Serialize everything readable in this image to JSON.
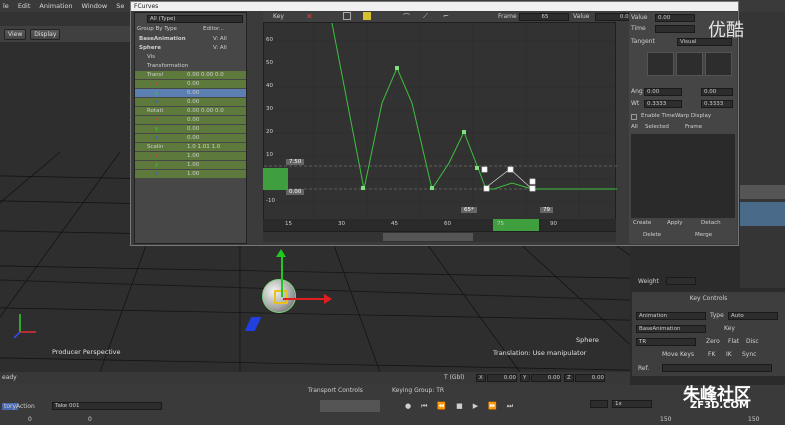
{
  "menu": [
    "le",
    "Edit",
    "Animation",
    "Window",
    "Se"
  ],
  "toolbar": {
    "view_label": "View",
    "display_label": "Display"
  },
  "viewport": {
    "camera_label": "Producer Perspective",
    "object_label": "Sphere",
    "status": "Translation: Use manipulator",
    "coords": {
      "prefix": "T (Gbl)",
      "x_label": "X",
      "x": "0.00",
      "y_label": "Y",
      "y": "0.00",
      "z_label": "Z",
      "z": "0.00"
    },
    "status_left": "eady"
  },
  "fcurves": {
    "title": "FCurves",
    "filter": "All (Type)",
    "group_by": "Group By Type",
    "editor": "Editor...",
    "tree": [
      {
        "indent": 0,
        "label": "BaseAnimation",
        "value": "V: All",
        "type": "header"
      },
      {
        "indent": 0,
        "label": "Sphere",
        "value": "V: All",
        "type": "header"
      },
      {
        "indent": 1,
        "label": "Vis",
        "value": "",
        "type": "item"
      },
      {
        "indent": 1,
        "label": "Transformation",
        "value": "",
        "type": "group"
      },
      {
        "indent": 1,
        "label": "Transl",
        "value": "0.00 0.00 0.0",
        "type": "prop"
      },
      {
        "indent": 2,
        "label": "x",
        "value": "0.00",
        "type": "channel",
        "color": "#ff3030"
      },
      {
        "indent": 2,
        "label": "y",
        "value": "0.00",
        "type": "channel",
        "color": "#30d030",
        "selected": true
      },
      {
        "indent": 2,
        "label": "z",
        "value": "0.00",
        "type": "channel",
        "color": "#3050ff"
      },
      {
        "indent": 1,
        "label": "Rotati",
        "value": "0.00 0.00 0.0",
        "type": "prop"
      },
      {
        "indent": 2,
        "label": "x",
        "value": "0.00",
        "type": "channel",
        "color": "#ff3030"
      },
      {
        "indent": 2,
        "label": "y",
        "value": "0.00",
        "type": "channel",
        "color": "#30d030"
      },
      {
        "indent": 2,
        "label": "z",
        "value": "0.00",
        "type": "channel",
        "color": "#3050ff"
      },
      {
        "indent": 1,
        "label": "Scalin",
        "value": "1.0 1.01 1.0",
        "type": "prop"
      },
      {
        "indent": 2,
        "label": "x",
        "value": "1.00",
        "type": "channel",
        "color": "#ff3030"
      },
      {
        "indent": 2,
        "label": "y",
        "value": "1.00",
        "type": "channel",
        "color": "#30d030"
      },
      {
        "indent": 2,
        "label": "z",
        "value": "1.00",
        "type": "channel",
        "color": "#3050ff"
      }
    ],
    "key_label": "Key",
    "frame_label": "Frame",
    "frame_value": "65",
    "value_label": "Value",
    "value_value": "0.00",
    "range_hi": "7.50",
    "range_lo": "0.00",
    "timeline_start": "65*",
    "timeline_end": "79",
    "y_ticks": [
      "60",
      "50",
      "40",
      "30",
      "20",
      "10",
      "0",
      "-10"
    ],
    "x_ticks": [
      "15",
      "30",
      "45",
      "60",
      "75",
      "90"
    ],
    "right": {
      "value_label": "Value",
      "value": "0.00",
      "time_label": "Time",
      "tangent_label": "Tangent",
      "tangent_value": "Visual",
      "ang_label": "Ang",
      "ang_value": "0.00",
      "ang_value2": "0.00",
      "wt_label": "Wt",
      "wt_value": "0.3333",
      "wt_value2": "0.3333",
      "timewarp_label": "Enable TimeWarp Display",
      "all_label": "All",
      "selected_label": "Selected",
      "frame_btn": "Frame",
      "buttons": [
        "Create",
        "Apply",
        "Detach",
        "Delete",
        "Merge"
      ]
    }
  },
  "key_controls": {
    "title": "Key Controls",
    "animation": "Animation",
    "type_label": "Type",
    "type_value": "Auto",
    "base_animation": "BaseAnimation",
    "keys_label": "Key",
    "tr": "TR",
    "zero": "Zero",
    "flat": "Flat",
    "disc": "Disc",
    "move_keys": "Move Keys",
    "fk": "FK",
    "ik": "IK",
    "sync": "Sync",
    "ref_label": "Ref.",
    "weight_label": "Weight"
  },
  "transport": {
    "title": "Transport Controls",
    "keying_group": "Keying Group: TR",
    "story": "tory",
    "action": "Action",
    "take": "Take 001",
    "frame_start": "0",
    "frame_mid": "0",
    "speed": "1x",
    "end": "150",
    "end2": "150"
  },
  "watermark": {
    "brand": "朱峰社区",
    "url": "ZF3D.COM",
    "site": "优酷"
  }
}
